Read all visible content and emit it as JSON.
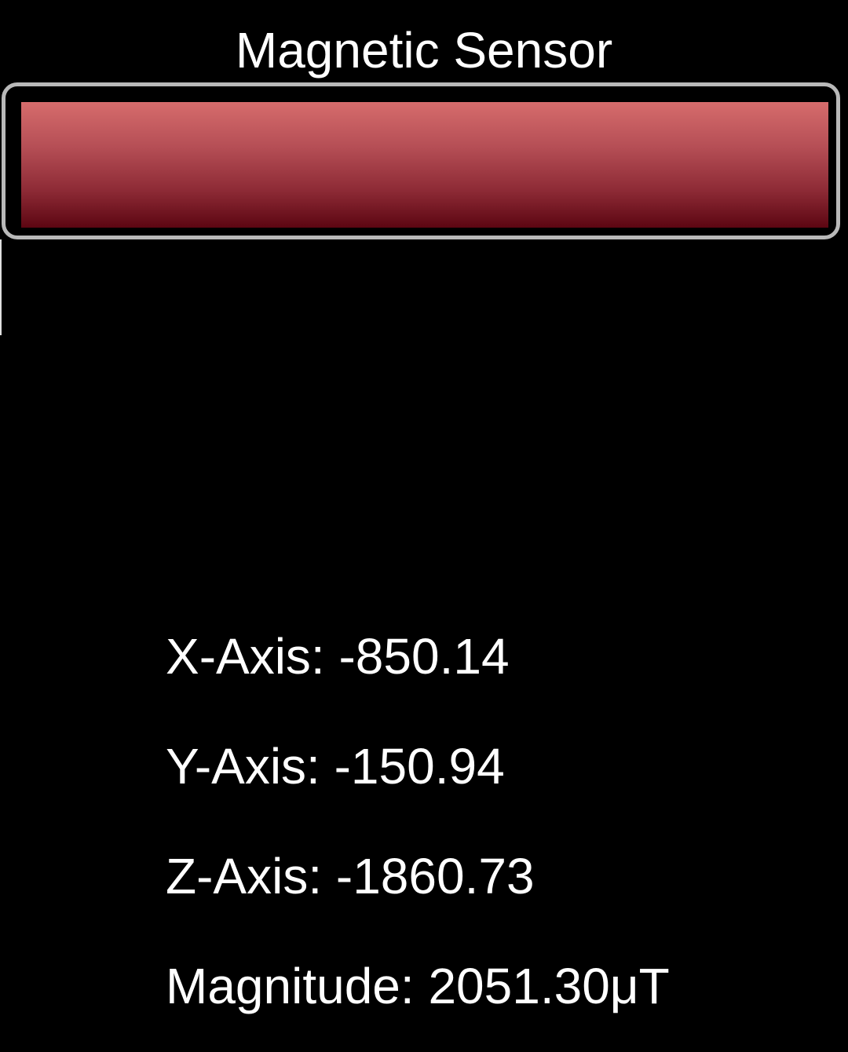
{
  "app": {
    "title": "Magnetic Sensor"
  },
  "meter": {
    "level_fraction": 1.0,
    "fill_color": "#a8404a",
    "frame_color": "#b9b9b9"
  },
  "readings": {
    "x_axis": "X-Axis: -850.14",
    "y_axis": "Y-Axis: -150.94",
    "z_axis": "Z-Axis: -1860.73",
    "magnitude": "Magnitude: 2051.30μT"
  }
}
